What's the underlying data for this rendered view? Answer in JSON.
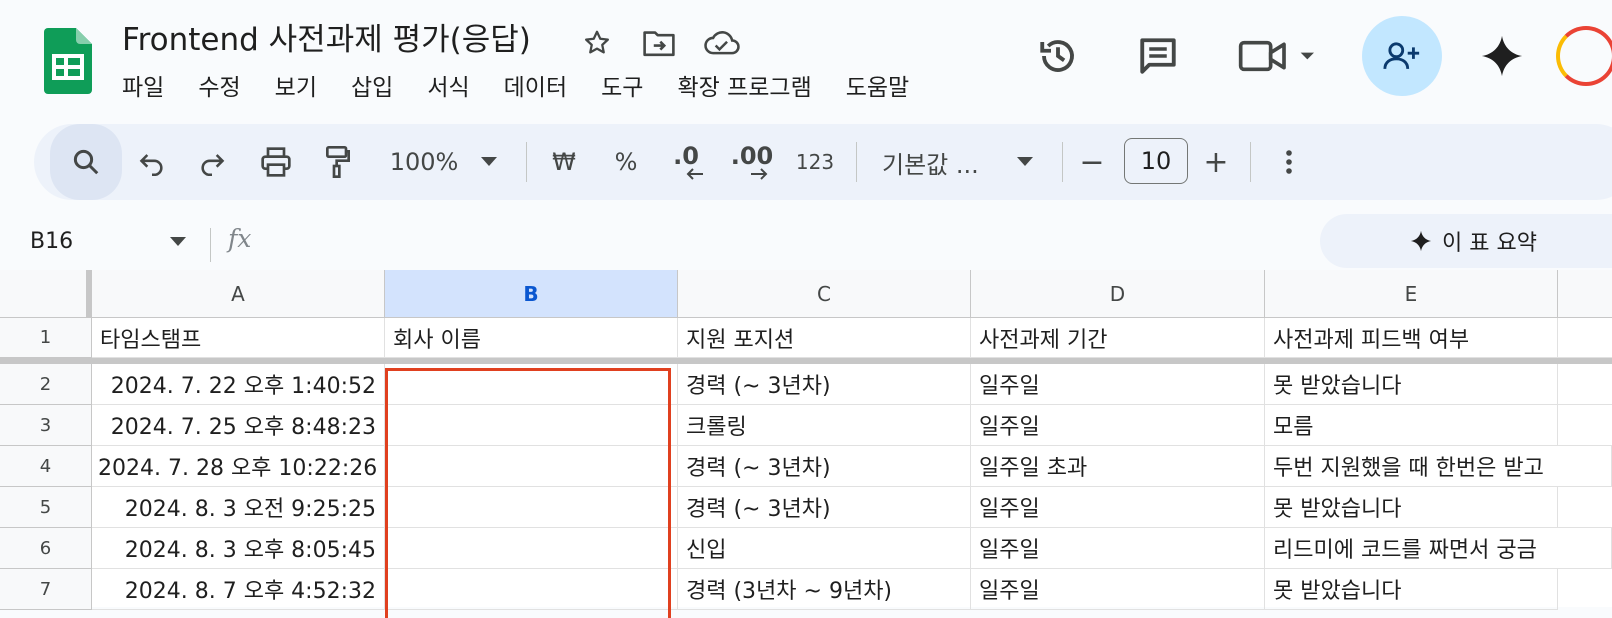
{
  "app": {
    "logo_icon": "google-sheets-logo-icon",
    "accent": "#0f9d58"
  },
  "document": {
    "title": "Frontend 사전과제 평가(응답)"
  },
  "menu": [
    "파일",
    "수정",
    "보기",
    "삽입",
    "서식",
    "데이터",
    "도구",
    "확장 프로그램",
    "도움말"
  ],
  "header_icons": [
    "star-icon",
    "move-folder-icon",
    "cloud-saved-icon",
    "version-history-icon",
    "comments-icon",
    "meet-video-icon",
    "share-add-person-icon",
    "gemini-sparkle-icon"
  ],
  "toolbar": {
    "zoom": "100%",
    "currency": "₩",
    "percent": "%",
    "decrease_decimal": ".0",
    "increase_decimal": ".00",
    "more_formats": "123",
    "font": "기본값 ...",
    "minus": "−",
    "font_size": "10",
    "plus": "+"
  },
  "formula_bar": {
    "name_box": "B16",
    "fx": "fx",
    "summarize_label": "이 표 요약"
  },
  "sheet": {
    "selected_column": "B",
    "columns": [
      "A",
      "B",
      "C",
      "D",
      "E"
    ],
    "row_numbers": [
      "1",
      "2",
      "3",
      "4",
      "5",
      "6",
      "7"
    ],
    "header_row": [
      "타임스탬프",
      "회사 이름",
      "지원 포지션",
      "사전과제 기간",
      "사전과제 피드백 여부"
    ],
    "rows": [
      [
        "2024. 7. 22 오후 1:40:52",
        "",
        "경력 (~ 3년차)",
        "일주일",
        "못 받았습니다"
      ],
      [
        "2024. 7. 25 오후 8:48:23",
        "",
        "크롤링",
        "일주일",
        "모름"
      ],
      [
        "2024. 7. 28 오후 10:22:26",
        "",
        "경력 (~ 3년차)",
        "일주일 초과",
        "두번 지원했을 때 한번은 받고"
      ],
      [
        "2024. 8. 3 오전 9:25:25",
        "",
        "경력 (~ 3년차)",
        "일주일",
        "못 받았습니다"
      ],
      [
        "2024. 8. 3 오후 8:05:45",
        "",
        "신입",
        "일주일",
        "리드미에 코드를 짜면서 궁금"
      ],
      [
        "2024. 8. 7 오후 4:52:32",
        "",
        "경력 (3년차 ~ 9년차)",
        "일주일",
        "못 받았습니다"
      ]
    ],
    "highlight_color": "#e0401f"
  }
}
